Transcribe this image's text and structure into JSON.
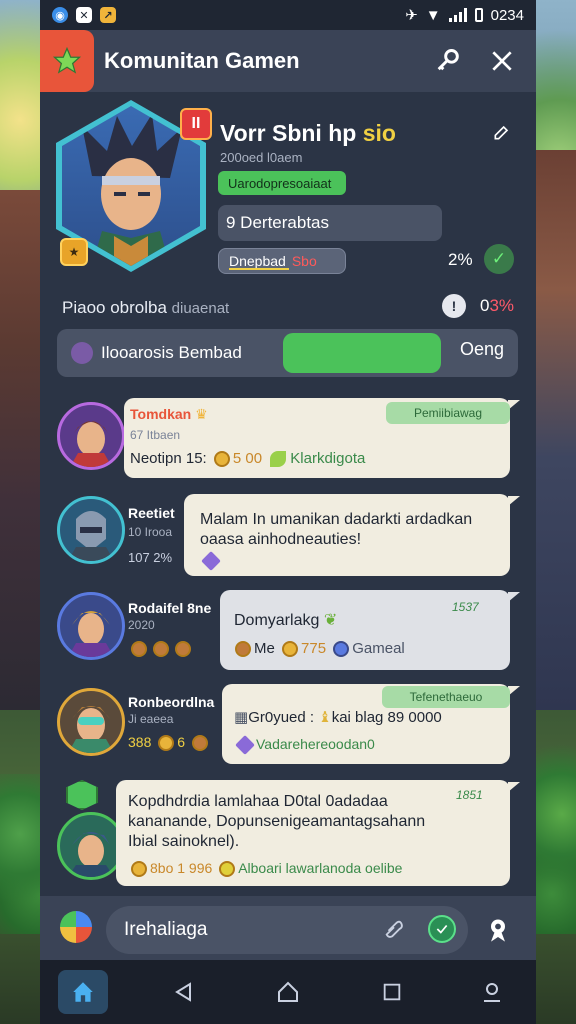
{
  "status": {
    "icons": [
      "round-app-icon",
      "box-app-icon",
      "chart-app-icon"
    ],
    "time": "0234"
  },
  "header": {
    "title": "Komunitan Gamen",
    "logo_icon": "star-icon",
    "key_icon": "key-icon",
    "close_icon": "close-icon"
  },
  "profile": {
    "name": "Vorr Sbni hp",
    "name_accent": "sio",
    "subtitle": "200oed l0aem",
    "green_pill": "Uarodopresoaiaat",
    "gray_box": "9 Derterabtas",
    "bar_label": "Dnepbad",
    "bar_red": "Sbo",
    "bar_fill": 0.6,
    "percent": "2%",
    "rank_badge": "II",
    "level_badge": "★"
  },
  "section": {
    "label": "Piaoo obrolba",
    "label_dim": "diuaenat",
    "count": "0",
    "count_red": "3%"
  },
  "search": {
    "text": "Ilooarosis Bembad",
    "button": "Oeng"
  },
  "messages": [
    {
      "sender": "Tomdkan",
      "meta": "67 Itbaen",
      "tag": "Pemiibiawag",
      "line": "Neotipn 15:",
      "coins": "5 00",
      "extra": "Klarkdigota"
    },
    {
      "sender": "Reetiet",
      "meta": "10 Irooa",
      "meta2": "107 2%",
      "text": "Malam In umanikan dadarkti ardadkan oaasa ainhodneauties!"
    },
    {
      "sender": "Rodaifel 8ne",
      "meta": "2020",
      "title": "Domyarlakg",
      "tag": "1537",
      "me": "Me",
      "coins": "775",
      "extra": "Gameal"
    },
    {
      "sender": "Ronbeordlna",
      "meta": "Ji eaeea",
      "meta2": "388",
      "meta3": "6",
      "tag": "Tefenethaeuo",
      "line": "Gr0yued :",
      "line2": "kai blag 89 0000",
      "extra": "Vadarehereoodan0"
    },
    {
      "tag": "1851",
      "text": "Kopdhdrdia lamlahaa D0tal 0adadaa kananande, Dopunsenigeamantagsahann Ibial sainoknel).",
      "coins": "8bo 1 996",
      "extra": "Alboari lawarlanoda oelibe"
    }
  ],
  "input": {
    "placeholder": "Irehaliaga"
  },
  "colors": {
    "panel": "#2b3445",
    "accent_green": "#4bc25a",
    "accent_orange": "#e8553a",
    "bubble": "#f1ede0"
  }
}
